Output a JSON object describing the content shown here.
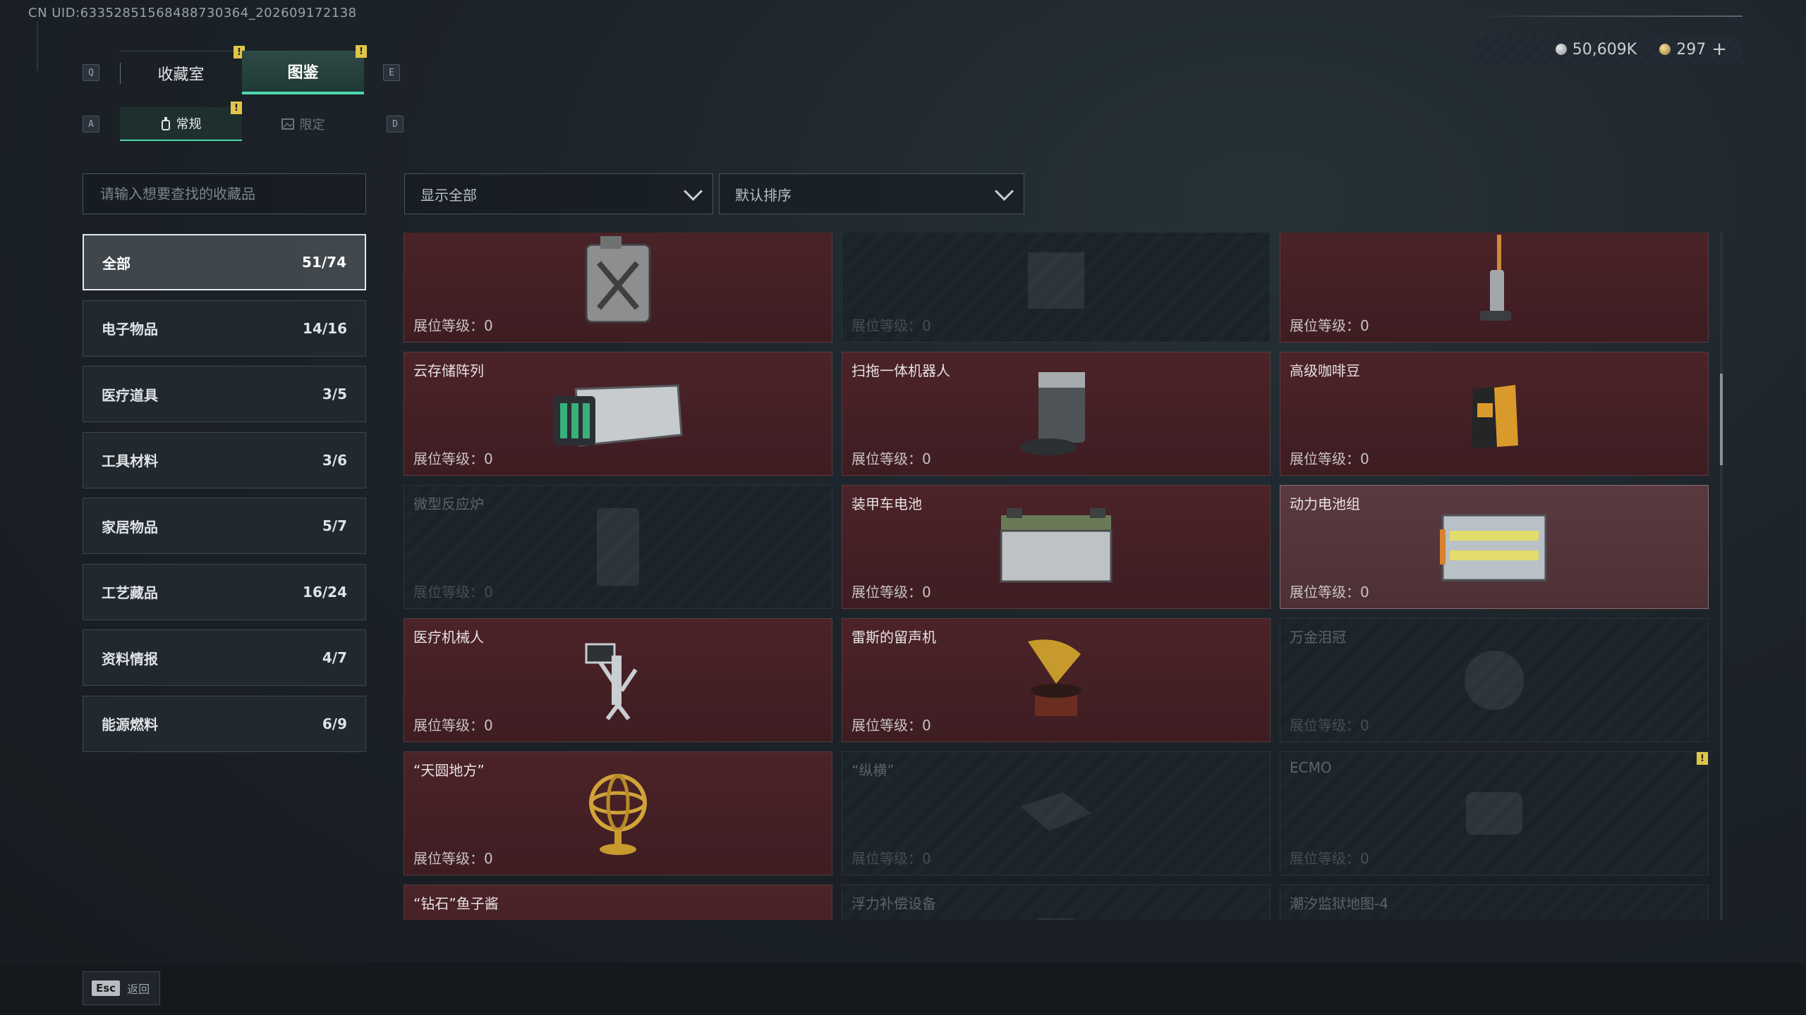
{
  "uid_text": "CN UID:633528515684887303​64_202609172138",
  "currency": {
    "silver": "50,609K",
    "gold": "297",
    "plus": "+"
  },
  "keys": {
    "prev_tab": "Q",
    "next_tab": "E",
    "prev_sub": "A",
    "next_sub": "D"
  },
  "main_tabs": [
    {
      "label": "收藏室",
      "active": false,
      "badge": "!"
    },
    {
      "label": "图鉴",
      "active": true,
      "badge": "!"
    }
  ],
  "sub_tabs": [
    {
      "label": "常规",
      "active": true,
      "badge": "!"
    },
    {
      "label": "限定",
      "active": false
    }
  ],
  "search": {
    "placeholder": "请输入想要查找的收藏品"
  },
  "filters": {
    "show": "显示全部",
    "sort": "默认排序"
  },
  "categories": [
    {
      "label": "全部",
      "count": "51/74",
      "active": true
    },
    {
      "label": "电子物品",
      "count": "14/16"
    },
    {
      "label": "医疗道具",
      "count": "3/5"
    },
    {
      "label": "工具材料",
      "count": "3/6"
    },
    {
      "label": "家居物品",
      "count": "5/7"
    },
    {
      "label": "工艺藏品",
      "count": "16/24"
    },
    {
      "label": "资料情报",
      "count": "4/7"
    },
    {
      "label": "能源燃料",
      "count": "6/9"
    }
  ],
  "level_label": "展位等级：0",
  "cards": [
    {
      "name": "",
      "locked": false,
      "icon": "jerrycan-icon"
    },
    {
      "name": "",
      "locked": true,
      "icon": "machine-icon"
    },
    {
      "name": "",
      "locked": false,
      "icon": "floor-washer-icon"
    },
    {
      "name": "云存储阵列",
      "locked": false,
      "icon": "server-array-icon"
    },
    {
      "name": "扫拖一体机器人",
      "locked": false,
      "icon": "robot-vacuum-icon"
    },
    {
      "name": "高级咖啡豆",
      "locked": false,
      "icon": "coffee-bag-icon"
    },
    {
      "name": "微型反应炉",
      "locked": true,
      "icon": "reactor-icon"
    },
    {
      "name": "装甲车电池",
      "locked": false,
      "icon": "car-battery-icon"
    },
    {
      "name": "动力电池组",
      "locked": false,
      "icon": "battery-pack-icon",
      "highlight": true
    },
    {
      "name": "医疗机械人",
      "locked": false,
      "icon": "medical-robot-icon"
    },
    {
      "name": "雷斯的留声机",
      "locked": false,
      "icon": "gramophone-icon"
    },
    {
      "name": "万金泪冠",
      "locked": true,
      "icon": "crown-icon"
    },
    {
      "name": "“天圆地方”",
      "locked": false,
      "icon": "armillary-sphere-icon"
    },
    {
      "name": "“纵横”",
      "locked": true,
      "icon": "board-icon"
    },
    {
      "name": "ECMO",
      "locked": true,
      "icon": "ecmo-icon",
      "badge": "!"
    },
    {
      "name": "“钻石”鱼子酱",
      "locked": false,
      "icon": "caviar-tin-icon"
    },
    {
      "name": "浮力补偿设备",
      "locked": true,
      "icon": "bcd-icon"
    },
    {
      "name": "潮汐监狱地图-4",
      "locked": true,
      "icon": "map-icon"
    }
  ],
  "footer": {
    "esc_key": "Esc",
    "back_label": "返回"
  }
}
